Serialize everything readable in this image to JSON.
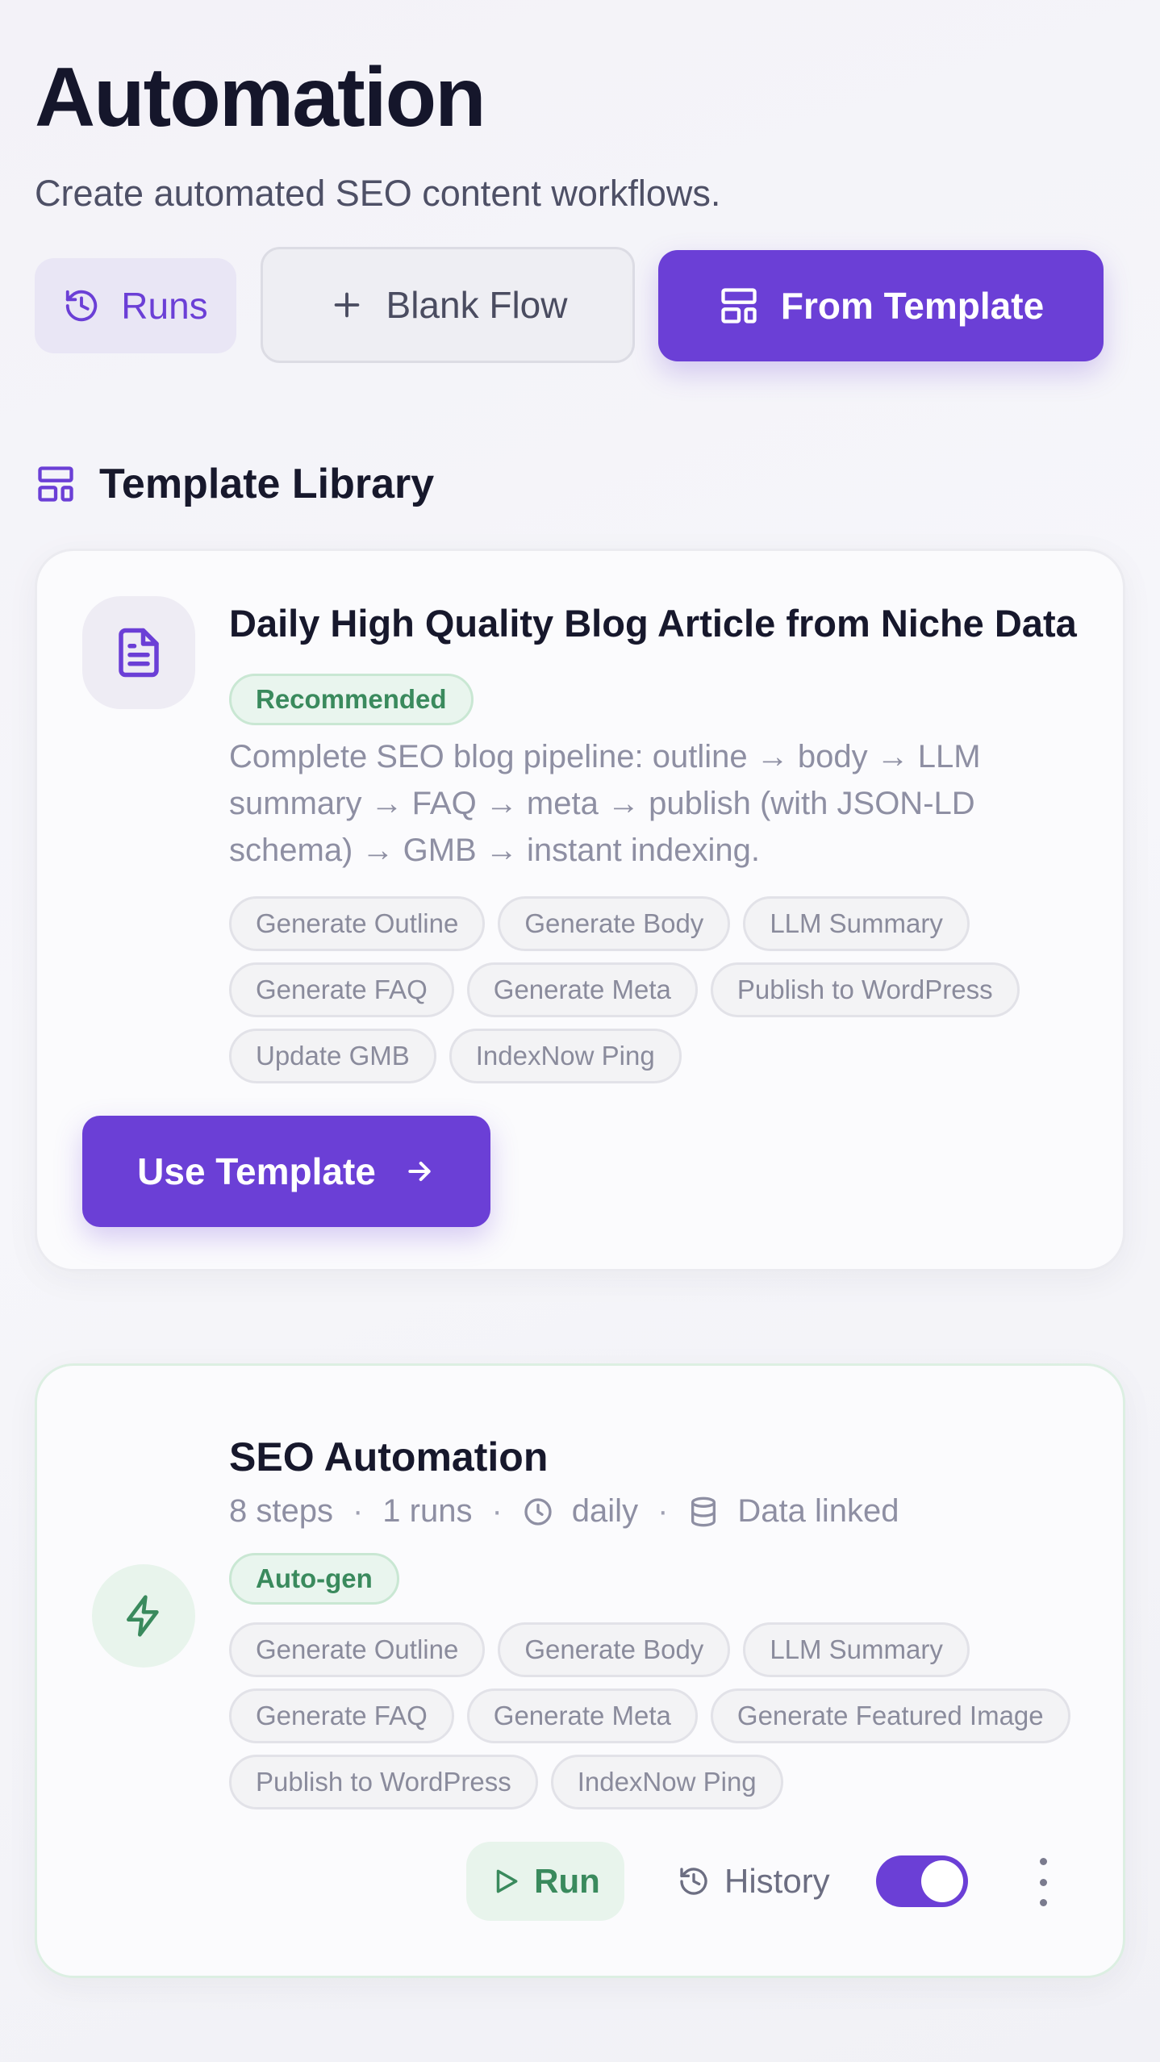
{
  "header": {
    "title": "Automation",
    "subtitle": "Create automated SEO content workflows."
  },
  "buttons": {
    "runs": "Runs",
    "blank_flow": "Blank Flow",
    "from_template": "From Template"
  },
  "library": {
    "title": "Template Library"
  },
  "template_card": {
    "title": "Daily High Quality Blog Article from Niche Data",
    "badge": "Recommended",
    "description": "Complete SEO blog pipeline: outline → body → LLM summary → FAQ → meta → publish (with JSON-LD schema) → GMB → instant indexing.",
    "steps": [
      "Generate Outline",
      "Generate Body",
      "LLM Summary",
      "Generate FAQ",
      "Generate Meta",
      "Publish to WordPress",
      "Update GMB",
      "IndexNow Ping"
    ],
    "use_button": "Use Template"
  },
  "automation_card": {
    "title": "SEO Automation",
    "steps_count": "8 steps",
    "runs_count": "1 runs",
    "schedule": "daily",
    "data_status": "Data linked",
    "badge": "Auto-gen",
    "steps": [
      "Generate Outline",
      "Generate Body",
      "LLM Summary",
      "Generate FAQ",
      "Generate Meta",
      "Generate Featured Image",
      "Publish to WordPress",
      "IndexNow Ping"
    ],
    "run_button": "Run",
    "history_button": "History",
    "enabled": true
  },
  "colors": {
    "accent": "#6b3fd6",
    "success": "#3a8a5d"
  },
  "icons": {
    "runs": "history-icon",
    "blank_flow": "plus-icon",
    "from_template": "layout-template-icon",
    "library": "layout-template-icon",
    "template_card": "file-text-icon",
    "automation_card": "zap-icon",
    "schedule": "clock-icon",
    "data": "database-icon",
    "use_template": "arrow-right-icon",
    "run": "play-icon",
    "history": "history-icon",
    "more": "more-vertical-icon"
  }
}
